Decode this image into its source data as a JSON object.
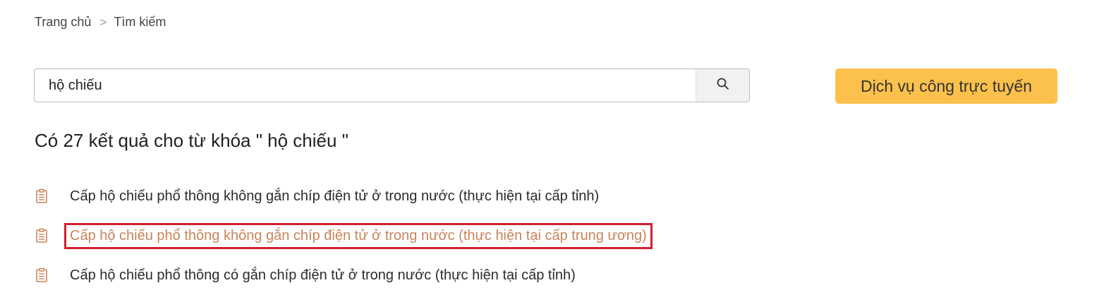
{
  "breadcrumb": {
    "home": "Trang chủ",
    "separator": ">",
    "current": "Tìm kiếm"
  },
  "search": {
    "value": "hộ chiếu",
    "icon": "search-icon"
  },
  "cta": {
    "label": "Dịch vụ công trực tuyến",
    "color": "#fcc14c"
  },
  "results": {
    "heading": "Có 27 kết quả cho từ khóa \" hộ chiếu \"",
    "items": [
      {
        "label": "Cấp hộ chiếu phổ thông không gắn chíp điện tử ở trong nước (thực hiện tại cấp tỉnh)",
        "icon": "document-icon"
      },
      {
        "label": "Cấp hộ chiếu phổ thông không gắn chíp điện tử ở trong nước (thực hiện tại cấp trung ương)",
        "icon": "document-icon"
      },
      {
        "label": "Cấp hộ chiếu phổ thông có gắn chíp điện tử ở trong nước (thực hiện tại cấp tỉnh)",
        "icon": "document-icon"
      }
    ]
  },
  "colors": {
    "accent_link": "#c8845a",
    "highlight_border": "#d1202f",
    "icon": "#c8845a"
  }
}
